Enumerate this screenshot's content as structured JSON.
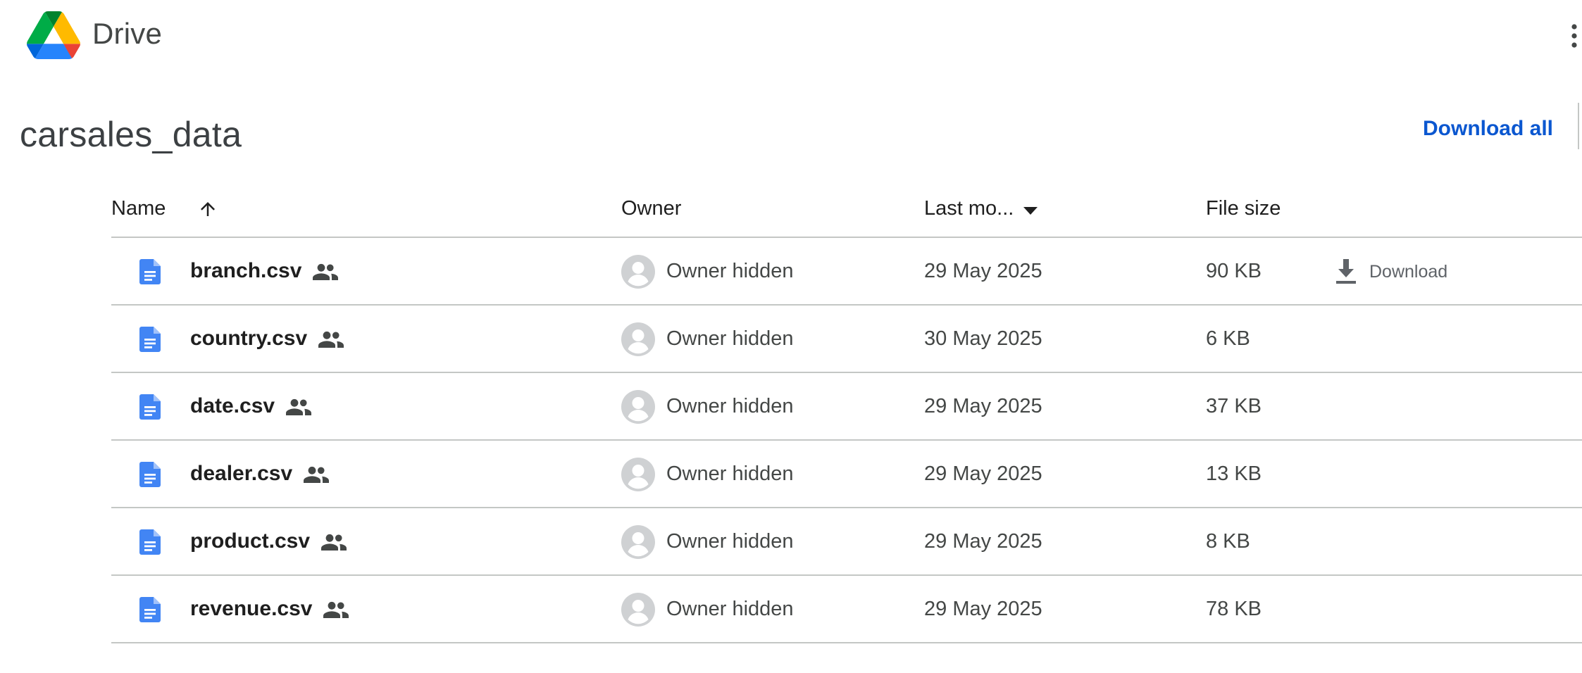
{
  "header": {
    "brand": "Drive",
    "logo_icon": "google-drive-logo",
    "more_icon": "more-vert-icon"
  },
  "folder": {
    "title": "carsales_data",
    "download_all_label": "Download all"
  },
  "colors": {
    "accent": "#0b57d0",
    "file_icon": "#4285f4",
    "divider": "#c4c7c5",
    "text_secondary": "#444746"
  },
  "table": {
    "columns": {
      "name": "Name",
      "owner": "Owner",
      "modified": "Last mo...",
      "size": "File size"
    },
    "sort": {
      "name_direction": "ascending",
      "modified_menu": "caret-down-icon"
    },
    "row_download_label": "Download",
    "rows": [
      {
        "name": "branch.csv",
        "owner": "Owner hidden",
        "modified": "29 May 2025",
        "size": "90 KB"
      },
      {
        "name": "country.csv",
        "owner": "Owner hidden",
        "modified": "30 May 2025",
        "size": "6 KB"
      },
      {
        "name": "date.csv",
        "owner": "Owner hidden",
        "modified": "29 May 2025",
        "size": "37 KB"
      },
      {
        "name": "dealer.csv",
        "owner": "Owner hidden",
        "modified": "29 May 2025",
        "size": "13 KB"
      },
      {
        "name": "product.csv",
        "owner": "Owner hidden",
        "modified": "29 May 2025",
        "size": "8 KB"
      },
      {
        "name": "revenue.csv",
        "owner": "Owner hidden",
        "modified": "29 May 2025",
        "size": "78 KB"
      }
    ]
  }
}
